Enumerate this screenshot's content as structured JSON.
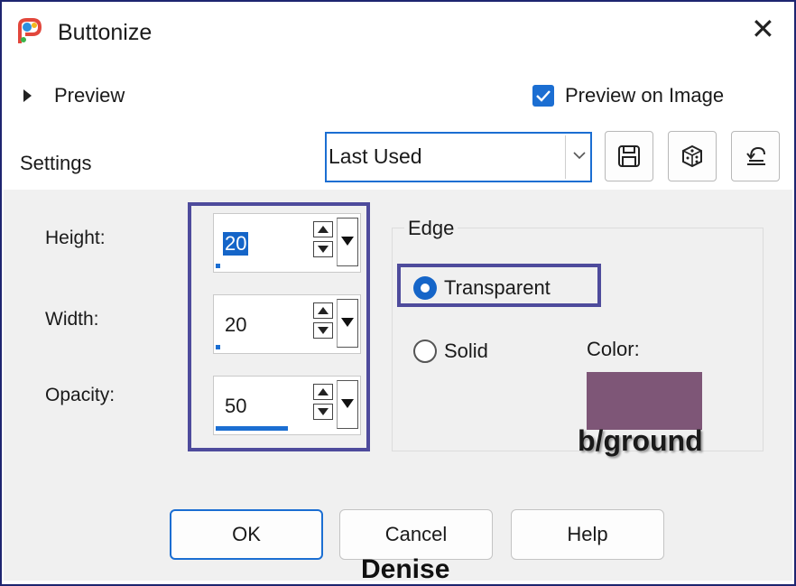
{
  "window": {
    "title": "Buttonize",
    "close_glyph": "✕",
    "icon": "paintshop-pro-icon"
  },
  "preview": {
    "label": "Preview",
    "preview_on_image_label": "Preview on Image",
    "preview_on_image_checked": true
  },
  "settings": {
    "label": "Settings",
    "preset_value": "Last Used",
    "toolbar_icons": [
      "save-icon",
      "randomize-dice-icon",
      "reset-icon"
    ]
  },
  "fields": {
    "height": {
      "label": "Height:",
      "value": "20",
      "slider_fraction": 0.03
    },
    "width": {
      "label": "Width:",
      "value": "20",
      "slider_fraction": 0.03
    },
    "opacity": {
      "label": "Opacity:",
      "value": "50",
      "slider_fraction": 0.5
    }
  },
  "edge": {
    "group_label": "Edge",
    "options": [
      {
        "label": "Transparent",
        "selected": true
      },
      {
        "label": "Solid",
        "selected": false
      }
    ],
    "color_label": "Color:",
    "color_value": "#7e5677",
    "color_annotation": "b/ground"
  },
  "buttons": {
    "ok": "OK",
    "cancel": "Cancel",
    "help": "Help"
  },
  "signature": "Denise",
  "colors": {
    "accent": "#1b6ed2",
    "highlight_border": "#4e4b9c",
    "panel_bg": "#f0f0f0"
  }
}
